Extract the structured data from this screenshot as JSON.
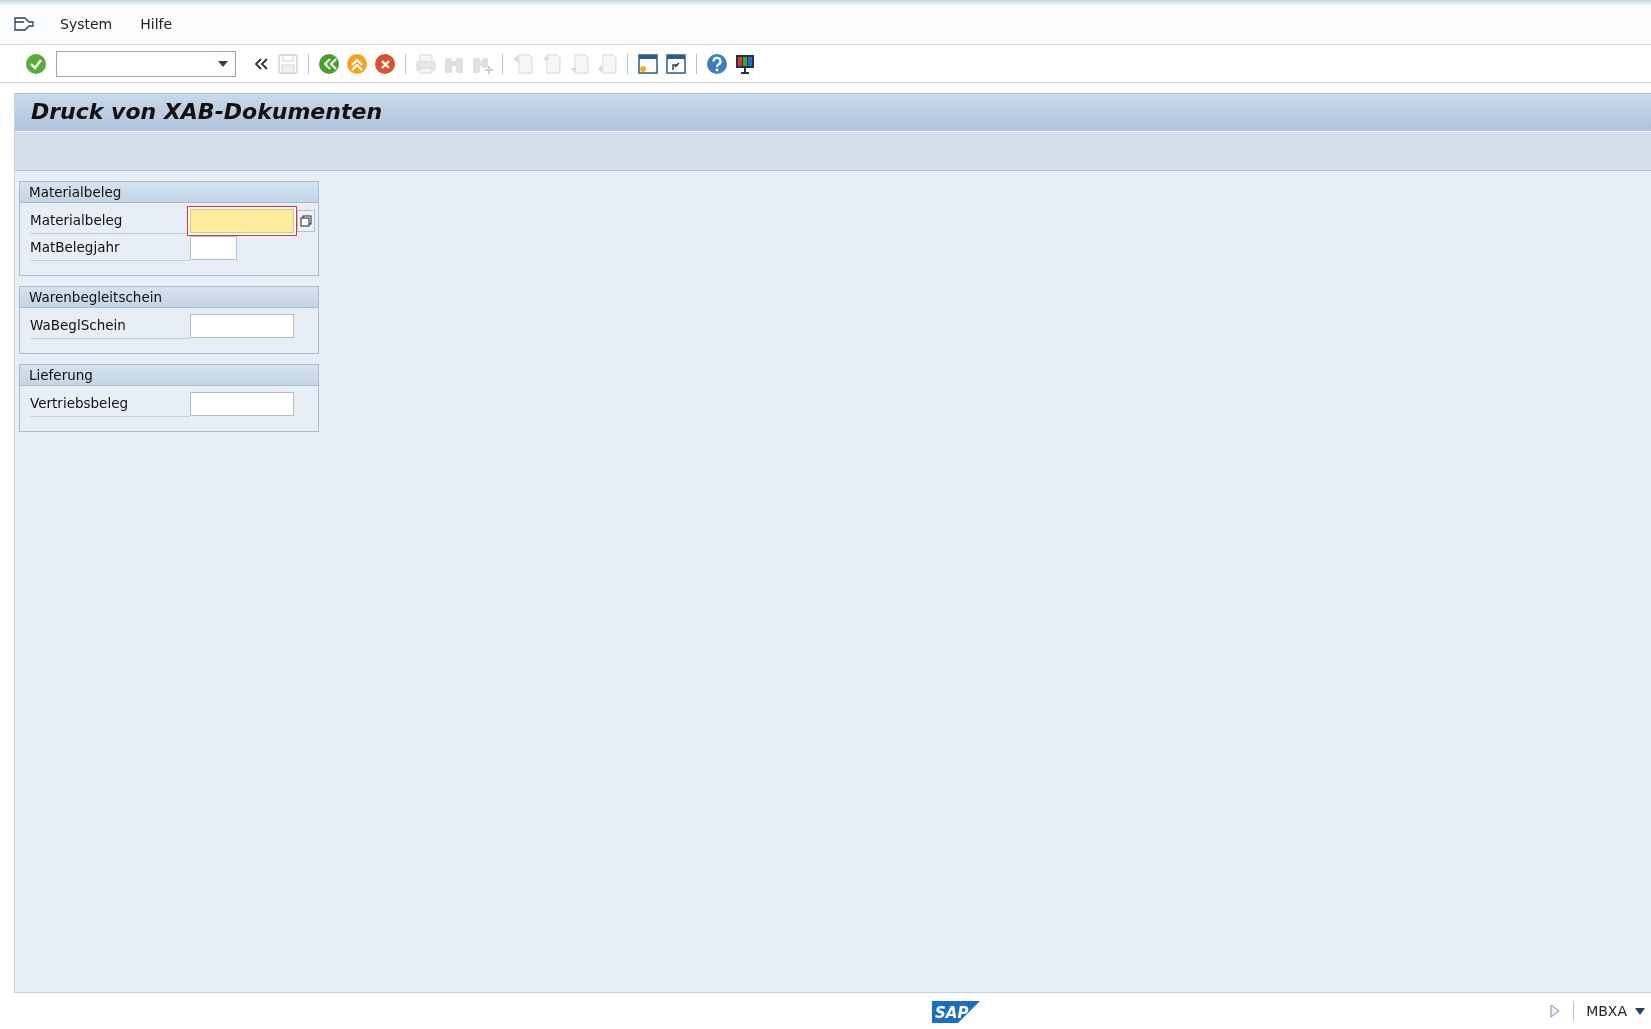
{
  "menu_bar": {
    "items": [
      "System",
      "Hilfe"
    ]
  },
  "toolbar": {
    "items": [
      {
        "kind": "enter",
        "disabled": false
      },
      {
        "kind": "command-field"
      },
      {
        "kind": "collapse",
        "disabled": false
      },
      {
        "kind": "save",
        "disabled": true
      },
      {
        "kind": "separator"
      },
      {
        "kind": "back",
        "disabled": false
      },
      {
        "kind": "exit",
        "disabled": false
      },
      {
        "kind": "cancel",
        "disabled": false
      },
      {
        "kind": "separator"
      },
      {
        "kind": "print",
        "disabled": true
      },
      {
        "kind": "find",
        "disabled": true
      },
      {
        "kind": "find-next",
        "disabled": true
      },
      {
        "kind": "separator"
      },
      {
        "kind": "first-page",
        "disabled": true
      },
      {
        "kind": "previous-page",
        "disabled": true
      },
      {
        "kind": "next-page",
        "disabled": true
      },
      {
        "kind": "last-page",
        "disabled": true
      },
      {
        "kind": "separator"
      },
      {
        "kind": "new-session",
        "disabled": false
      },
      {
        "kind": "shortcut",
        "disabled": false
      },
      {
        "kind": "separator"
      },
      {
        "kind": "help",
        "disabled": false
      },
      {
        "kind": "layout",
        "disabled": false
      }
    ]
  },
  "title": "Druck von XAB-Dokumenten",
  "groups": [
    {
      "title": "Materialbeleg",
      "fields": [
        {
          "label": "Materialbeleg",
          "kind": "long",
          "focused": true
        },
        {
          "label": "MatBelegjahr",
          "kind": "short",
          "focused": false
        }
      ]
    },
    {
      "title": "Warenbegleitschein",
      "fields": [
        {
          "label": "WaBeglSchein",
          "kind": "long",
          "focused": false
        }
      ]
    },
    {
      "title": "Lieferung",
      "fields": [
        {
          "label": "Vertriebsbeleg",
          "kind": "long",
          "focused": false
        }
      ]
    }
  ],
  "status_bar": {
    "logo": "SAP",
    "transaction": "MBXA"
  }
}
